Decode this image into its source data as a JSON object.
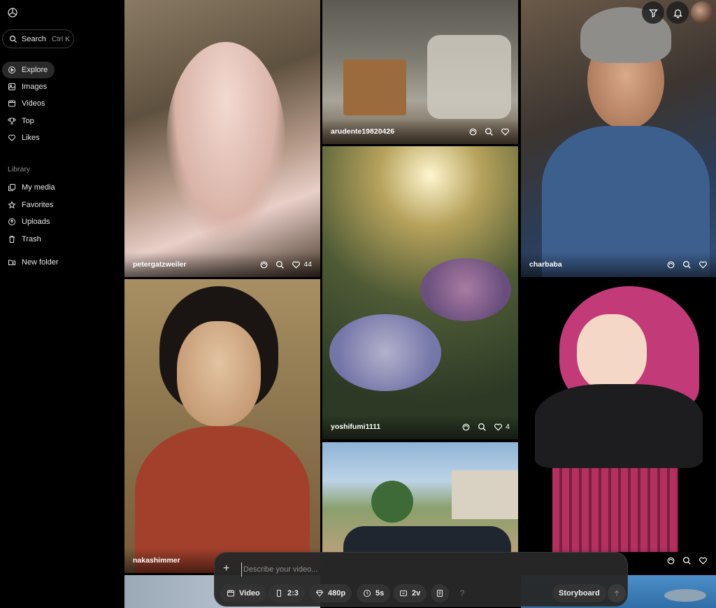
{
  "sidebar": {
    "search_label": "Search",
    "search_shortcut": "Ctrl K",
    "nav": [
      {
        "label": "Explore",
        "icon": "play-circle-icon"
      },
      {
        "label": "Images",
        "icon": "image-icon"
      },
      {
        "label": "Videos",
        "icon": "film-icon"
      },
      {
        "label": "Top",
        "icon": "trophy-icon"
      },
      {
        "label": "Likes",
        "icon": "heart-icon"
      }
    ],
    "library_label": "Library",
    "library": [
      {
        "label": "My media",
        "icon": "media-icon"
      },
      {
        "label": "Favorites",
        "icon": "star-icon"
      },
      {
        "label": "Uploads",
        "icon": "upload-icon"
      },
      {
        "label": "Trash",
        "icon": "trash-icon"
      },
      {
        "label": "New folder",
        "icon": "folder-plus-icon"
      }
    ]
  },
  "gallery": [
    {
      "user": "petergatzweiler",
      "likes": "44"
    },
    {
      "user": "arudente19820426",
      "likes": ""
    },
    {
      "user": "charbaba",
      "likes": ""
    },
    {
      "user": "yoshifumi1111",
      "likes": "4"
    },
    {
      "user": "nakashimmer",
      "likes": ""
    },
    {
      "user": "",
      "likes": ""
    }
  ],
  "composer": {
    "placeholder": "Describe your video...",
    "type_label": "Video",
    "aspect_label": "2:3",
    "resolution_label": "480p",
    "duration_label": "5s",
    "variants_label": "2v",
    "help_label": "?",
    "storyboard_label": "Storyboard"
  },
  "colors": {
    "background": "#000000",
    "sidebar_active": "#2a2a2a",
    "composer_bg": "#282828"
  }
}
